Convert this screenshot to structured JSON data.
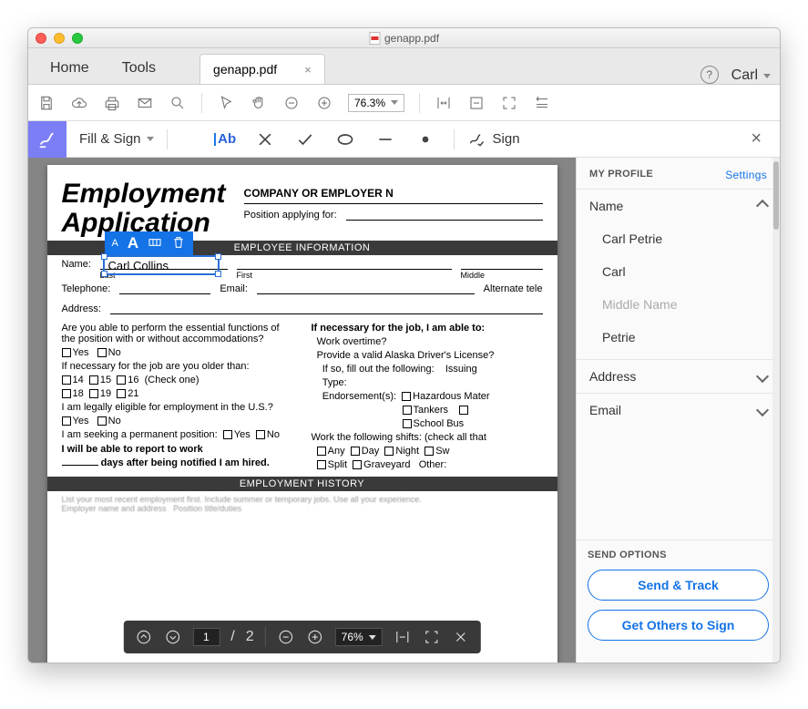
{
  "window": {
    "title": "genapp.pdf"
  },
  "tabs": {
    "home": "Home",
    "tools": "Tools",
    "file": "genapp.pdf",
    "user": "Carl"
  },
  "toolbar": {
    "zoom": "76.3%"
  },
  "fillSign": {
    "label": "Fill & Sign",
    "ab": "Ab",
    "sign": "Sign"
  },
  "doc": {
    "title1": "Employment",
    "title2": "Application",
    "companyLabel": "COMPANY OR EMPLOYER N",
    "positionLabel": "Position applying for:",
    "banner1": "EMPLOYEE INFORMATION",
    "name": "Name:",
    "last": "Last",
    "first": "First",
    "middle": "Middle",
    "tel": "Telephone:",
    "email": "Email:",
    "altTel": "Alternate tele",
    "address": "Address:",
    "q1": "Are you able to perform the essential functions of the position with or without accommodations?",
    "yes": "Yes",
    "no": "No",
    "q2": "If necessary for the job are you older than:",
    "a14": "14",
    "a15": "15",
    "a16": "16",
    "checkOne": "(Check one)",
    "a18": "18",
    "a19": "19",
    "a21": "21",
    "q3": "I am legally eligible for employment in the U.S.?",
    "q4": "I am seeking a permanent position:",
    "q5a": "I will be able to report to work",
    "q5b": "days after being notified I am hired.",
    "r1": "If necessary for the job, I am able to:",
    "r2": "Work overtime?",
    "r3": "Provide a valid Alaska Driver's License?",
    "r4": "If so, fill out the following:",
    "r4b": "Issuing",
    "r5": "Type:",
    "r6": "Endorsement(s):",
    "r6a": "Hazardous Mater",
    "r6b": "Tankers",
    "r6c": "School Bus",
    "r7": "Work the following shifts: (check all that",
    "r8a": "Any",
    "r8b": "Day",
    "r8c": "Night",
    "r8d": "Sw",
    "r9a": "Split",
    "r9b": "Graveyard",
    "r9c": "Other:",
    "banner2": "EMPLOYMENT HISTORY",
    "typed": "Carl Collins"
  },
  "side": {
    "profile": "MY PROFILE",
    "settings": "Settings",
    "name": "Name",
    "items": [
      "Carl Petrie",
      "Carl",
      "Middle Name",
      "Petrie"
    ],
    "address": "Address",
    "email": "Email",
    "sendOpt": "SEND OPTIONS",
    "b1": "Send & Track",
    "b2": "Get Others to Sign"
  },
  "bottom": {
    "page": "1",
    "pages": "2",
    "sep": "/",
    "zoom": "76%"
  }
}
